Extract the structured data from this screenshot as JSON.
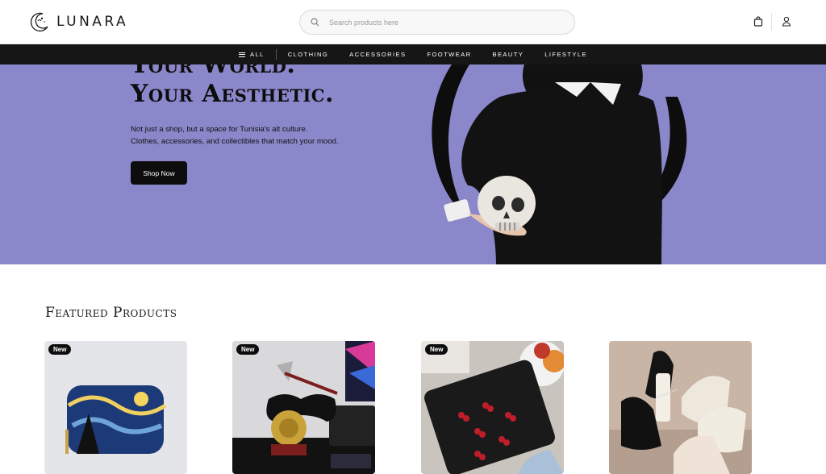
{
  "brand": {
    "name": "LUNARA"
  },
  "search": {
    "placeholder": "Search products here"
  },
  "header_icons": [
    "cart-icon",
    "user-icon"
  ],
  "nav": {
    "all_label": "ALL",
    "items": [
      "CLOTHING",
      "ACCESSORIES",
      "FOOTWEAR",
      "BEAUTY",
      "LIFESTYLE"
    ]
  },
  "hero": {
    "title_line1": "Your World.",
    "title_line2": "Your Aesthetic.",
    "subtitle_line1": "Not just a shop, but a space for Tunisia's alt culture.",
    "subtitle_line2": "Clothes, accessories, and collectibles that match your mood.",
    "cta": "Shop Now",
    "background": "#8b87cb"
  },
  "featured": {
    "title": "Featured Products",
    "products": [
      {
        "badge": "New",
        "image": "starry-night-wallet"
      },
      {
        "badge": "New",
        "image": "axe-controller-stand"
      },
      {
        "badge": "New",
        "image": "cherry-embroidered-bag"
      },
      {
        "badge": "",
        "image": "platform-mary-jane-shoes"
      }
    ]
  },
  "colors": {
    "accent": "#8b87cb",
    "nav_bg": "#161616",
    "button_bg": "#0d0d0d"
  }
}
